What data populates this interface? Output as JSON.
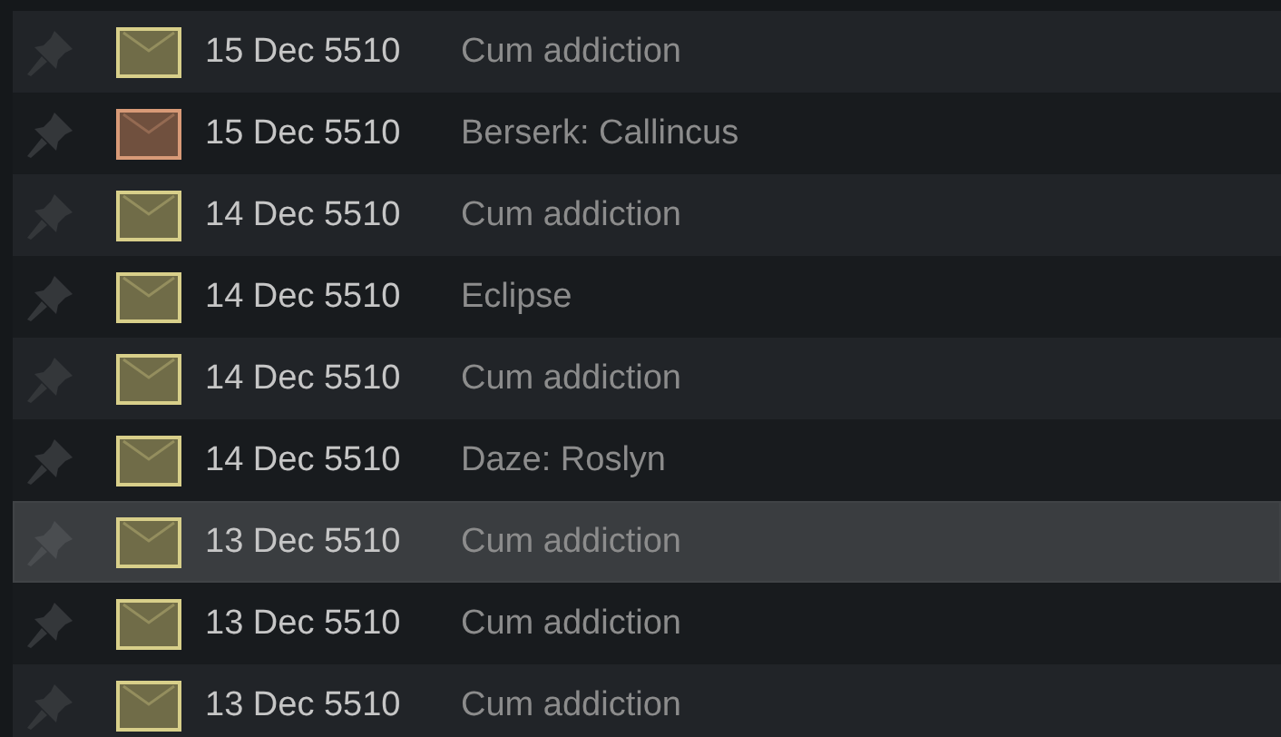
{
  "messages": [
    {
      "date": "15 Dec 5510",
      "title": "Cum addiction",
      "color": "#d8cf8a",
      "selected": false
    },
    {
      "date": "15 Dec 5510",
      "title": "Berserk: Callincus",
      "color": "#d89a77",
      "selected": false
    },
    {
      "date": "14 Dec 5510",
      "title": "Cum addiction",
      "color": "#d8cf8a",
      "selected": false
    },
    {
      "date": "14 Dec 5510",
      "title": "Eclipse",
      "color": "#d8cf8a",
      "selected": false
    },
    {
      "date": "14 Dec 5510",
      "title": "Cum addiction",
      "color": "#d8cf8a",
      "selected": false
    },
    {
      "date": "14 Dec 5510",
      "title": "Daze: Roslyn",
      "color": "#d8cf8a",
      "selected": false
    },
    {
      "date": "13 Dec 5510",
      "title": "Cum addiction",
      "color": "#d8cf8a",
      "selected": true
    },
    {
      "date": "13 Dec 5510",
      "title": "Cum addiction",
      "color": "#d8cf8a",
      "selected": false
    },
    {
      "date": "13 Dec 5510",
      "title": "Cum addiction",
      "color": "#d8cf8a",
      "selected": false
    }
  ]
}
